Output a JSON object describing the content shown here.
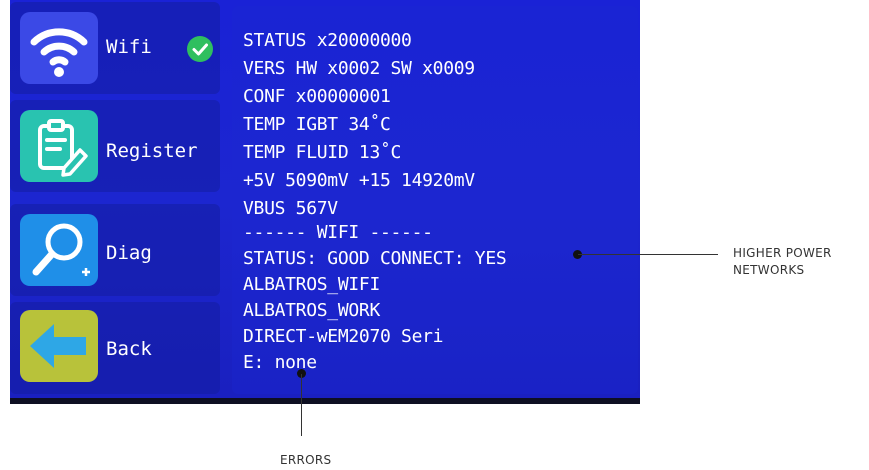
{
  "sidebar": {
    "items": [
      {
        "label": "Wifi",
        "icon": "wifi-icon",
        "tile_color": "#3b49e6"
      },
      {
        "label": "Register",
        "icon": "clipboard-edit-icon",
        "tile_color": "#29c3b0"
      },
      {
        "label": "Diag",
        "icon": "magnifier-icon",
        "tile_color": "#1f8fe8"
      },
      {
        "label": "Back",
        "icon": "arrow-left-icon",
        "tile_color": "#b8c23a"
      }
    ],
    "wifi_status_icon": "check-circle-icon"
  },
  "info_panel": {
    "lines": [
      "STATUS x20000000",
      "VERS HW x0002 SW x0009",
      "CONF x00000001",
      "TEMP IGBT 34˚C",
      "TEMP FLUID 13˚C",
      "+5V 5090mV +15 14920mV",
      "VBUS 567V",
      "------ WIFI ------",
      "STATUS: GOOD CONNECT: YES",
      "ALBATROS_WIFI",
      "ALBATROS_WORK",
      "DIRECT-wEM2070 Seri",
      "E: none"
    ]
  },
  "annotations": {
    "networks_line1": "HIGHER POWER",
    "networks_line2": "NETWORKS",
    "errors": "ERRORS"
  },
  "colors": {
    "screen_blue": "#1a22d6",
    "check_green": "#2fbf5f"
  }
}
